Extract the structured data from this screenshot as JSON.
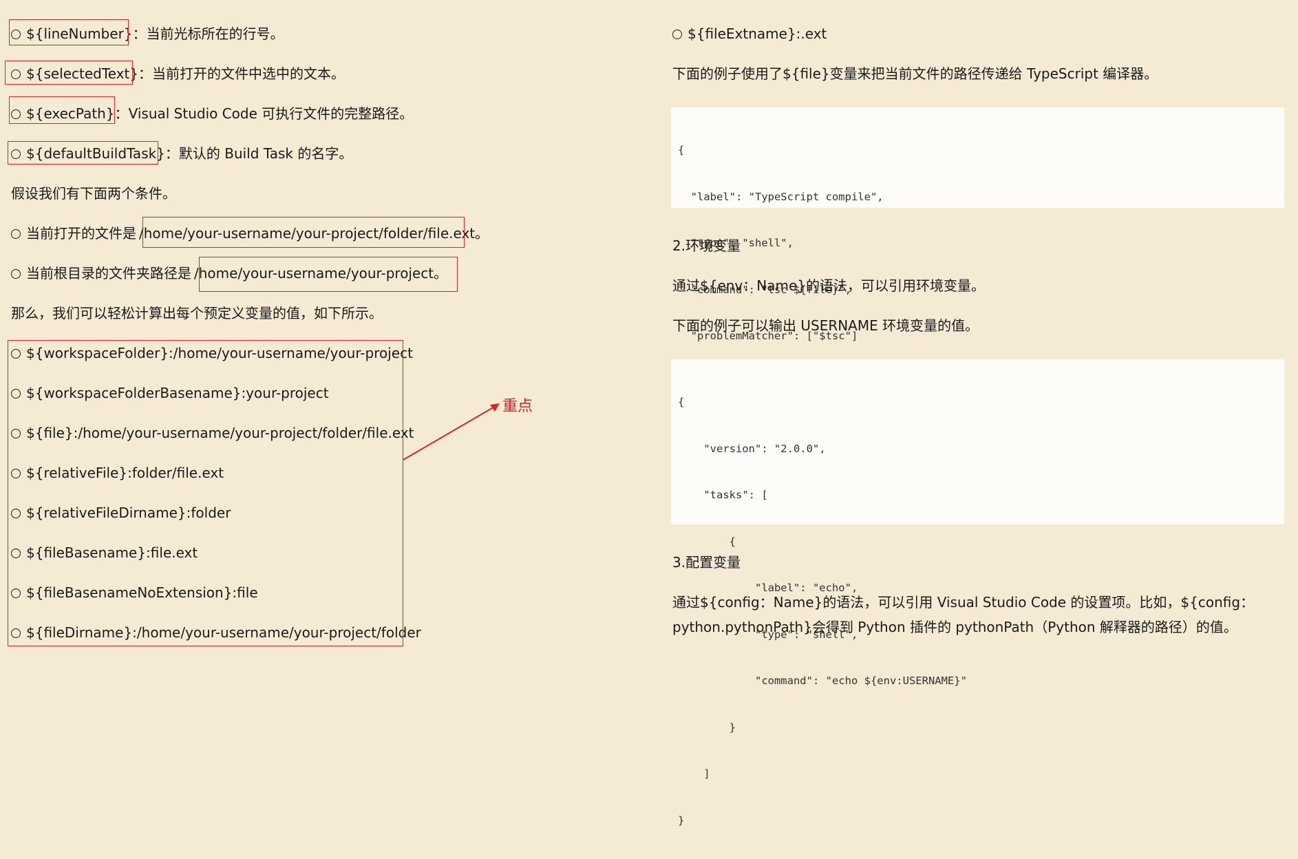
{
  "left": {
    "items": [
      {
        "circle": true,
        "code": "${lineNumber}",
        "sep": "：",
        "text": "当前光标所在的行号。"
      },
      {
        "circle": true,
        "code": "${selectedText}",
        "sep": "：",
        "text": "当前打开的文件中选中的文本。"
      },
      {
        "circle": true,
        "code": "${execPath}",
        "sep": "：",
        "text": "Visual Studio Code 可执行文件的完整路径。"
      },
      {
        "circle": true,
        "code": "${defaultBuildTask}",
        "sep": "：",
        "text": "默认的 Build Task 的名字。"
      }
    ],
    "assume": "假设我们有下面两个条件。",
    "cond1": {
      "prefix": "当前打开的文件是",
      "path": "/home/your-username/your-project/folder/file.ext。"
    },
    "cond2": {
      "prefix": "当前根目录的文件夹路径是",
      "path": "/home/your-username/your-project。"
    },
    "conclude": "那么，我们可以轻松计算出每个预定义变量的值，如下所示。",
    "values": [
      "${workspaceFolder}:/home/your-username/your-project",
      "${workspaceFolderBasename}:your-project",
      "${file}:/home/your-username/your-project/folder/file.ext",
      "${relativeFile}:folder/file.ext",
      "${relativeFileDirname}:folder",
      "${fileBasename}:file.ext",
      "${fileBasenameNoExtension}:file",
      "${fileDirname}:/home/your-username/your-project/folder"
    ],
    "note": "重点"
  },
  "right": {
    "ext": "${fileExtname}:.ext",
    "example1_desc": "下面的例子使用了${file}变量来把当前文件的路径传递给 TypeScript 编译器。",
    "code1": [
      "{",
      "  \"label\": \"TypeScript compile\",",
      "  \"type\": \"shell\",",
      "  \"command\": \"tsc ${file}\",",
      "  \"problemMatcher\": [\"$tsc\"]",
      "}"
    ],
    "section2": "2.环境变量",
    "env_desc": "通过${env：Name}的语法，可以引用环境变量。",
    "example2_desc": "下面的例子可以输出 USERNAME 环境变量的值。",
    "code2": [
      "{",
      "    \"version\": \"2.0.0\",",
      "    \"tasks\": [",
      "        {",
      "            \"label\": \"echo\",",
      "            \"type\": \"shell\",",
      "            \"command\": \"echo ${env:USERNAME}\"",
      "        }",
      "    ]",
      "}"
    ],
    "section3": "3.配置变量",
    "config_line1": "通过${config：Name}的语法，可以引用 Visual   Studio   Code 的设置项。比如，${config：",
    "config_line2": "python.pythonPath}会得到 Python 插件的 pythonPath（Python 解释器的路径）的值。"
  },
  "colors": {
    "background": "#f5ead3",
    "highlight": "#d8232a",
    "code_bg": "#fdfcf8"
  }
}
